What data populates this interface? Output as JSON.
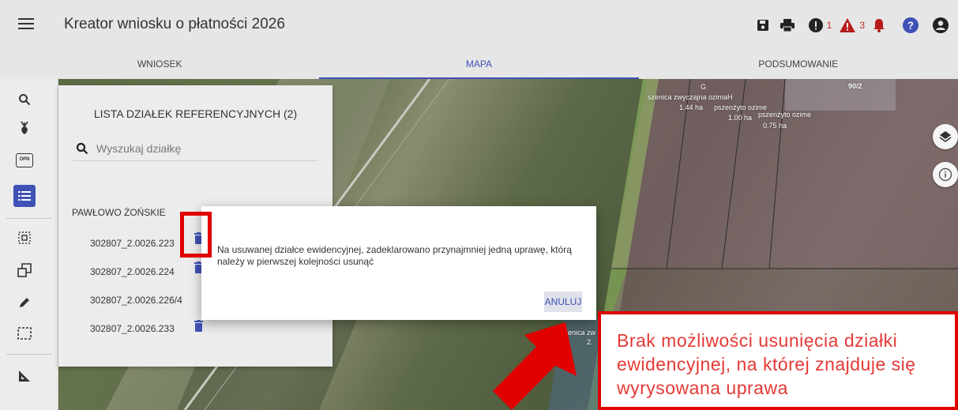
{
  "header": {
    "title": "Kreator wniosku o płatności 2026",
    "error_count": "1",
    "warning_count": "3",
    "icons": [
      "menu-icon",
      "save-icon",
      "print-icon",
      "error-icon",
      "warning-icon",
      "bell-icon",
      "help-icon",
      "account-icon"
    ]
  },
  "tabs": [
    {
      "label": "WNIOSEK",
      "active": false
    },
    {
      "label": "MAPA",
      "active": true
    },
    {
      "label": "PODSUMOWANIE",
      "active": false
    }
  ],
  "sidebar": {
    "icons": [
      "search-icon",
      "plant-icon",
      "opn-icon",
      "list-icon",
      "select-area-icon",
      "copy-shape-icon",
      "edit-icon",
      "select-rect-icon",
      "measure-icon"
    ],
    "opn_label": "OPN"
  },
  "parcel_panel": {
    "title": "LISTA DZIAŁEK REFERENCYJNYCH (2)",
    "search_placeholder": "Wyszukaj działkę",
    "group_name": "PAWŁOWO ŻOŃSKIE",
    "parcels": [
      "302807_2.0026.223",
      "302807_2.0026.224",
      "302807_2.0026.226/4",
      "302807_2.0026.233"
    ]
  },
  "map_labels": {
    "g": "G",
    "crop1": "szenica zwyczajna ozimaH",
    "area1": "1.44 ha",
    "crop2": "pszenżyto ozime",
    "area2": "1.00 ha",
    "crop3": "pszenżyto ozime",
    "area3": "0.75 ha",
    "parcel_no": "90/2",
    "crop4": "enica zw",
    "area4": "2."
  },
  "dialog": {
    "message": "Na usuwanej działce ewidencyjnej, zadeklarowano przynajmniej jedną uprawę, którą należy w pierwszej kolejności usunąć",
    "cancel_label": "ANULUJ"
  },
  "callout": {
    "text": "Brak możliwości usunięcia działki ewidencyjnej, na której znajduje się wyrysowana uprawa"
  },
  "colors": {
    "accent": "#3f51b5",
    "annotation_red": "#e00000",
    "warning_red": "#c62828",
    "help_blue": "#3f51b5"
  }
}
